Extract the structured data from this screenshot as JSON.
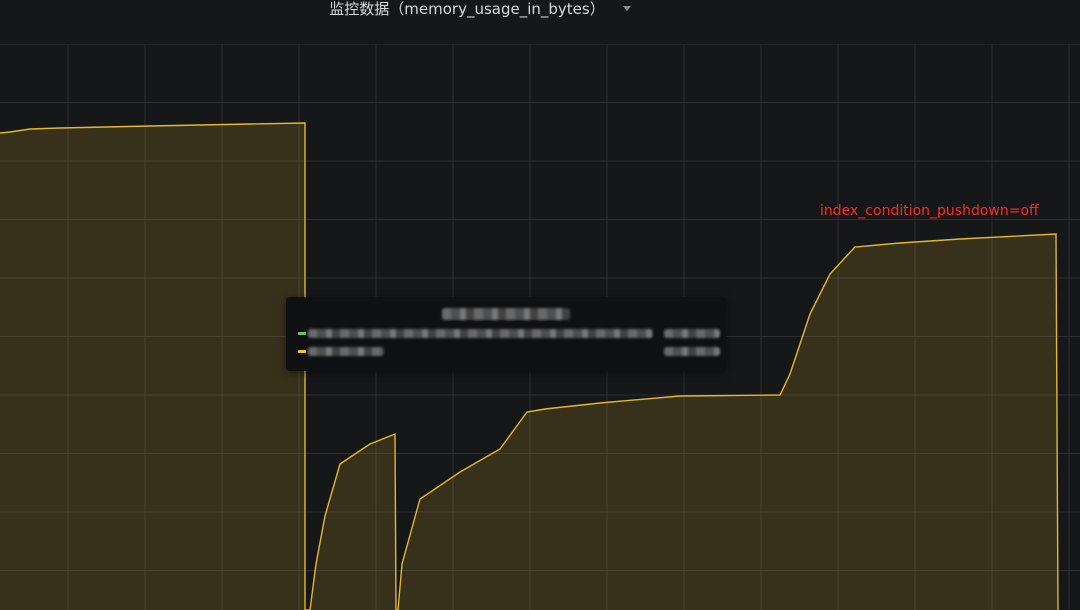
{
  "panel": {
    "title": "监控数据（memory_usage_in_bytes）",
    "annotation": "index_condition_pushdown=off"
  },
  "chart_data": {
    "type": "area",
    "series": [
      {
        "color": "#e5b72b",
        "values": [
          [
            0,
            89
          ],
          [
            10,
            88
          ],
          [
            30,
            85
          ],
          [
            60,
            84
          ],
          [
            150,
            82
          ],
          [
            250,
            80
          ],
          [
            305,
            79
          ],
          [
            305,
            566
          ],
          [
            310,
            566
          ],
          [
            316,
            520
          ],
          [
            325,
            472
          ],
          [
            340,
            420
          ],
          [
            355,
            410
          ],
          [
            370,
            400
          ],
          [
            385,
            394
          ],
          [
            395,
            390
          ],
          [
            396,
            566
          ],
          [
            398,
            566
          ],
          [
            402,
            520
          ],
          [
            420,
            455
          ],
          [
            460,
            428
          ],
          [
            500,
            405
          ],
          [
            527,
            368
          ],
          [
            545,
            365
          ],
          [
            600,
            359
          ],
          [
            680,
            352
          ],
          [
            780,
            351
          ],
          [
            790,
            330
          ],
          [
            810,
            270
          ],
          [
            830,
            230
          ],
          [
            855,
            203
          ],
          [
            900,
            199
          ],
          [
            960,
            195
          ],
          [
            1056,
            190
          ],
          [
            1058,
            566
          ]
        ]
      }
    ]
  }
}
